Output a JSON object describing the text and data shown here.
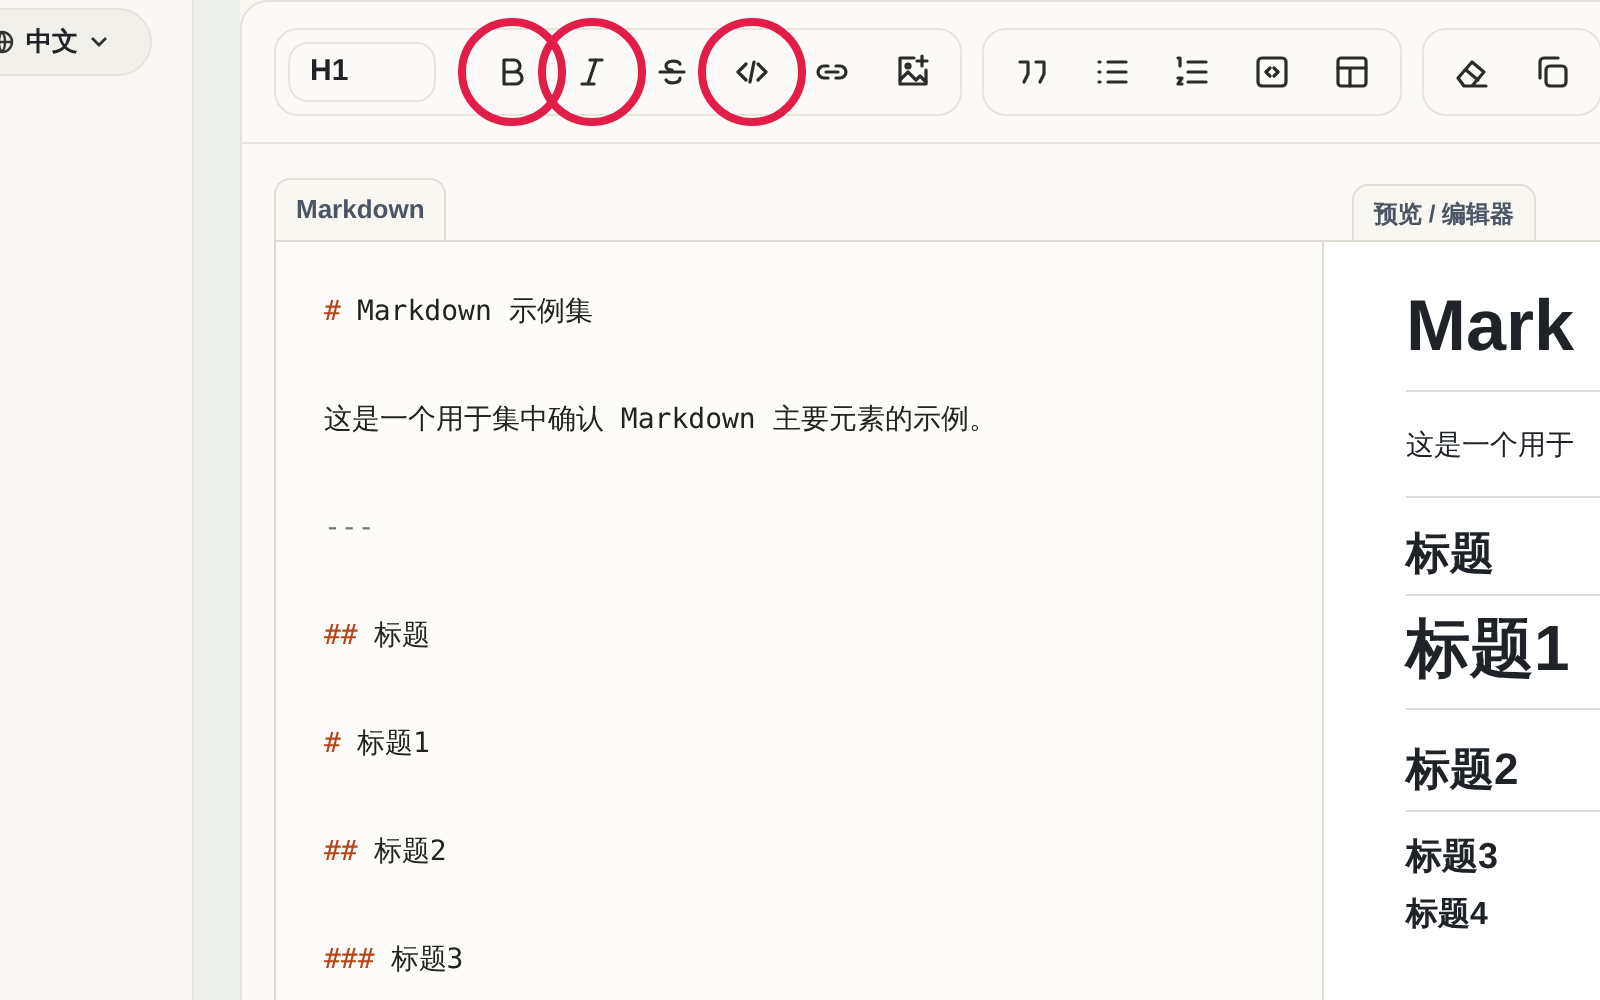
{
  "language_switcher": {
    "label": "中文"
  },
  "toolbar": {
    "heading_select": {
      "value": "H1"
    },
    "groups": [
      [
        {
          "kind": "bold",
          "highlighted": true
        },
        {
          "kind": "italic",
          "highlighted": true
        },
        {
          "kind": "strike",
          "highlighted": false
        },
        {
          "kind": "code",
          "highlighted": true
        },
        {
          "kind": "link",
          "highlighted": false
        },
        {
          "kind": "image",
          "highlighted": false
        }
      ],
      [
        {
          "kind": "quote",
          "highlighted": false
        },
        {
          "kind": "bullets",
          "highlighted": false
        },
        {
          "kind": "numbers",
          "highlighted": false
        },
        {
          "kind": "codeblock",
          "highlighted": false
        },
        {
          "kind": "table",
          "highlighted": false
        }
      ],
      [
        {
          "kind": "eraser",
          "highlighted": false
        },
        {
          "kind": "copy",
          "highlighted": false
        }
      ]
    ]
  },
  "editor": {
    "tab": "Markdown",
    "lines": [
      {
        "kind": "heading",
        "marker": "#",
        "text": "Markdown 示例集"
      },
      {
        "kind": "text",
        "text": "这是一个用于集中确认 Markdown 主要元素的示例。"
      },
      {
        "kind": "rule",
        "text": "---"
      },
      {
        "kind": "heading",
        "marker": "##",
        "text": "标题"
      },
      {
        "kind": "heading",
        "marker": "#",
        "text": "标题1"
      },
      {
        "kind": "heading",
        "marker": "##",
        "text": "标题2"
      },
      {
        "kind": "heading",
        "marker": "###",
        "text": "标题3"
      }
    ]
  },
  "preview": {
    "tab": "预览 / 编辑器",
    "blocks": [
      {
        "kind": "h1",
        "text": "Mark"
      },
      {
        "kind": "p",
        "text": "这是一个用于"
      },
      {
        "kind": "hr"
      },
      {
        "kind": "h2",
        "text": "标题"
      },
      {
        "kind": "h1",
        "text": "标题1"
      },
      {
        "kind": "h2",
        "text": "标题2"
      },
      {
        "kind": "h3",
        "text": "标题3"
      },
      {
        "kind": "h4",
        "text": "标题4"
      }
    ]
  }
}
